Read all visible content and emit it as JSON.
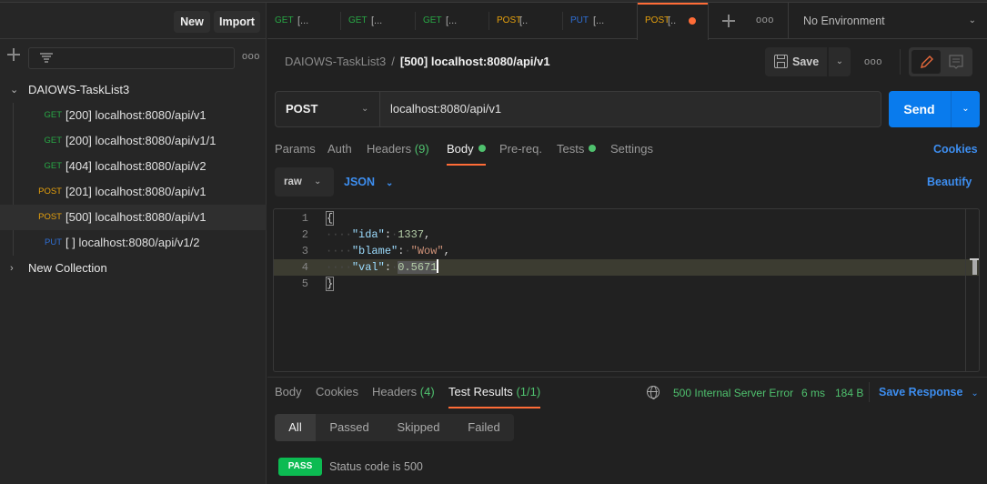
{
  "sidebar": {
    "new_label": "New",
    "import_label": "Import",
    "collections": [
      {
        "name": "DAIOWS-TaskList3",
        "expanded": true,
        "requests": [
          {
            "method": "GET",
            "label": "[200] localhost:8080/api/v1",
            "color": "#28a745"
          },
          {
            "method": "GET",
            "label": "[200] localhost:8080/api/v1/1",
            "color": "#28a745"
          },
          {
            "method": "GET",
            "label": "[404] localhost:8080/api/v2",
            "color": "#28a745"
          },
          {
            "method": "POST",
            "label": "[201] localhost:8080/api/v1",
            "color": "#e5a00d"
          },
          {
            "method": "POST",
            "label": "[500] localhost:8080/api/v1",
            "color": "#e5a00d",
            "active": true
          },
          {
            "method": "PUT",
            "label": "[ ] localhost:8080/api/v1/2",
            "color": "#2f6fd6"
          }
        ]
      },
      {
        "name": "New Collection",
        "expanded": false
      }
    ]
  },
  "tabs": [
    {
      "method": "GET",
      "title": "[...",
      "color": "#28a745"
    },
    {
      "method": "GET",
      "title": "[...",
      "color": "#28a745"
    },
    {
      "method": "GET",
      "title": "[...",
      "color": "#28a745"
    },
    {
      "method": "POST",
      "title": "[..",
      "color": "#e5a00d"
    },
    {
      "method": "PUT",
      "title": "[...",
      "color": "#2f6fd6"
    },
    {
      "method": "POST",
      "title": "[..",
      "color": "#e5a00d",
      "active": true,
      "unsaved": true
    }
  ],
  "environment": "No Environment",
  "breadcrumb": {
    "collection": "DAIOWS-TaskList3",
    "separator": "/",
    "current": "[500] localhost:8080/api/v1"
  },
  "toolbar": {
    "save_label": "Save"
  },
  "request": {
    "method": "POST",
    "url": "localhost:8080/api/v1",
    "send_label": "Send",
    "tabs": {
      "params": "Params",
      "auth": "Auth",
      "headers": "Headers",
      "headers_count": "(9)",
      "body": "Body",
      "prereq": "Pre-req.",
      "tests": "Tests",
      "settings": "Settings"
    },
    "cookies_label": "Cookies",
    "body_mode": "raw",
    "body_lang": "JSON",
    "beautify_label": "Beautify",
    "body_lines": [
      {
        "n": "1",
        "text": "{"
      },
      {
        "n": "2",
        "key": "\"ida\"",
        "value": "1337",
        "trail": ","
      },
      {
        "n": "3",
        "key": "\"blame\"",
        "value": "\"Wow\"",
        "trail": ","
      },
      {
        "n": "4",
        "key": "\"val\"",
        "value": "0.5671",
        "trail": ""
      },
      {
        "n": "5",
        "text": "}"
      }
    ]
  },
  "response": {
    "tabs": {
      "body": "Body",
      "cookies": "Cookies",
      "headers": "Headers",
      "headers_count": "(4)",
      "tests": "Test Results",
      "tests_count": "(1/1)"
    },
    "status": "500 Internal Server Error",
    "time": "6 ms",
    "size": "184 B",
    "save_label": "Save Response",
    "filters": [
      "All",
      "Passed",
      "Skipped",
      "Failed"
    ],
    "results": [
      {
        "badge": "PASS",
        "name": "Status code is 500"
      }
    ]
  }
}
